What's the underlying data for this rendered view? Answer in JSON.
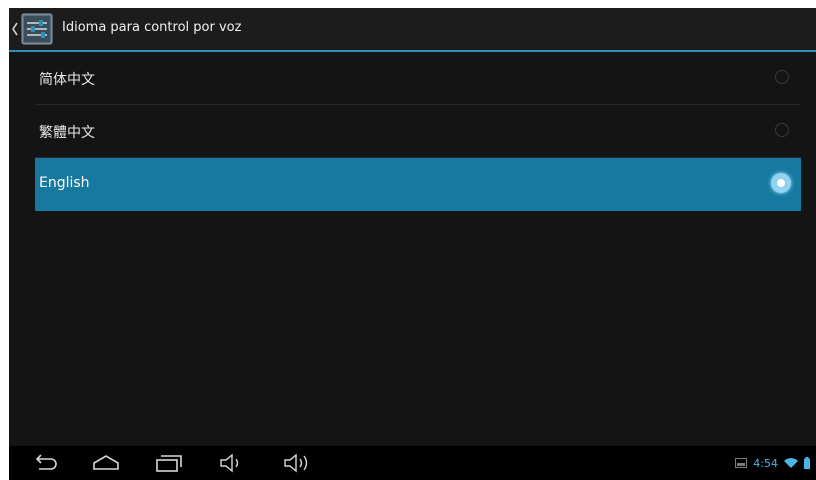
{
  "action_bar": {
    "title": "Idioma para control por voz",
    "app_icon": "settings-sliders-icon"
  },
  "languages": [
    {
      "label": "简体中文",
      "selected": false
    },
    {
      "label": "繁體中文",
      "selected": false
    },
    {
      "label": "English",
      "selected": true
    }
  ],
  "status_bar": {
    "time": "4:54",
    "icons": [
      "screenshot-icon",
      "wifi-icon",
      "battery-icon"
    ]
  },
  "nav_buttons": [
    "back-icon",
    "home-icon",
    "recent-apps-icon",
    "volume-down-icon",
    "volume-up-icon"
  ],
  "colors": {
    "accent": "#2f8fb7",
    "selected_row": "#1579a0",
    "clock": "#49b6e5",
    "background": "#141414"
  }
}
